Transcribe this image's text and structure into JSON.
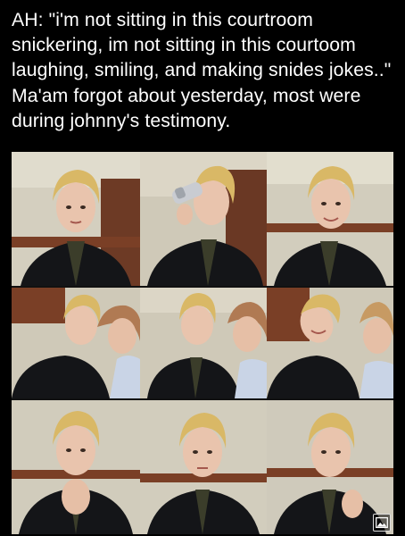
{
  "post": {
    "caption": "AH: \"i'm not sitting in this courtroom snickering, im not sitting in this courtoom laughing, smiling, and making snides jokes..\" Ma'am forgot about yesterday, most were during johnny's testimony."
  },
  "collage": {
    "icon": "image-gallery-icon",
    "colors": {
      "background": "#000000",
      "text": "#ffffff",
      "wall": "#d6d2c2",
      "wood": "#7a3f26",
      "jacket": "#141518",
      "hair": "#d9b866",
      "skin": "#e9c4ad"
    }
  }
}
